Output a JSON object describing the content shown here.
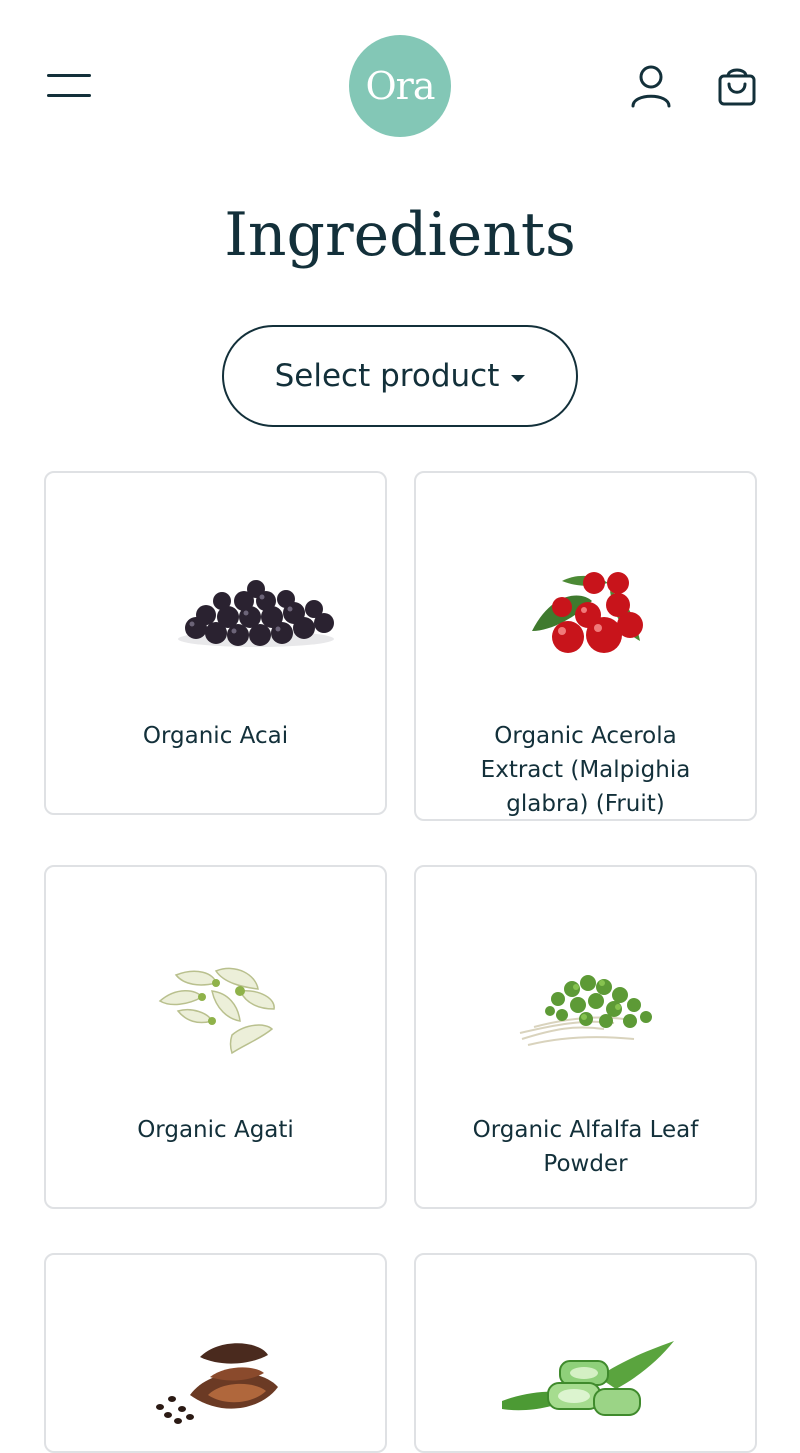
{
  "header": {
    "logo_text": "Ora",
    "menu_icon": "hamburger-menu-icon",
    "account_icon": "user-icon",
    "cart_icon": "shopping-bag-icon"
  },
  "page": {
    "title": "Ingredients"
  },
  "filter": {
    "label": "Select product"
  },
  "ingredients": [
    {
      "name": "Organic Acai",
      "image": "acai-berries-image"
    },
    {
      "name": "Organic Acerola Extract (Malpighia glabra) (Fruit)",
      "image": "acerola-cherries-image"
    },
    {
      "name": "Organic Agati",
      "image": "agati-flowers-image"
    },
    {
      "name": "Organic Alfalfa Leaf Powder",
      "image": "alfalfa-sprouts-image"
    },
    {
      "name": "",
      "image": "cacao-pods-image"
    },
    {
      "name": "",
      "image": "aloe-vera-image"
    }
  ],
  "colors": {
    "brand": "#83c7b6",
    "text": "#13303a",
    "card_border": "#dfe1e4"
  }
}
